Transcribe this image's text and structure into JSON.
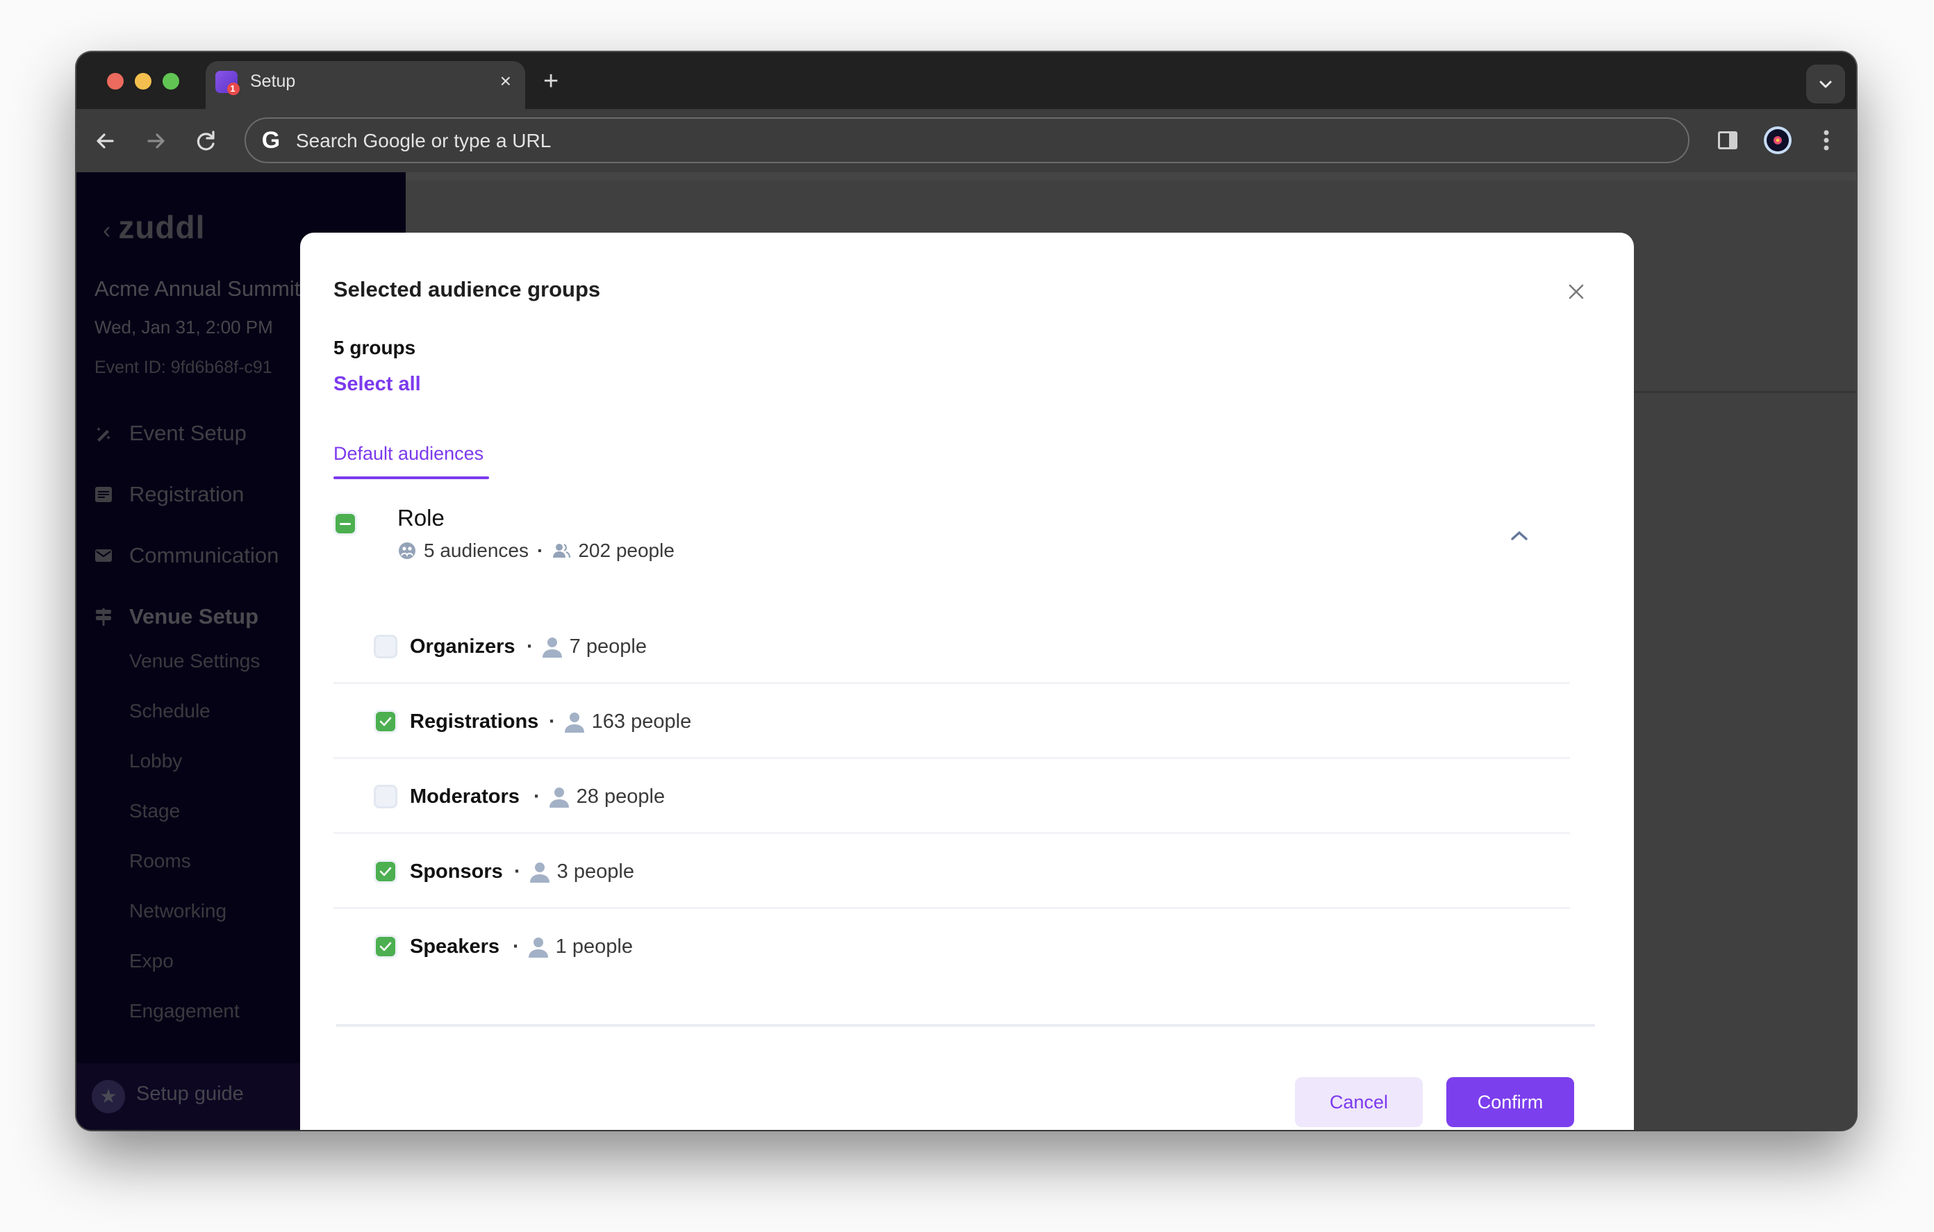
{
  "browser": {
    "tab_title": "Setup",
    "tab_badge": "1",
    "tab_close_glyph": "×",
    "new_tab_glyph": "+",
    "omnibox_placeholder": "Search Google or type a URL",
    "google_glyph": "G"
  },
  "sidebar": {
    "logo": "zuddl",
    "event_name": "Acme Annual Summit",
    "event_date": "Wed, Jan 31, 2:00 PM",
    "event_id": "Event ID: 9fd6b68f-c91",
    "nav": [
      {
        "label": "Event Setup",
        "icon": "magic-wand-icon"
      },
      {
        "label": "Registration",
        "icon": "form-icon"
      },
      {
        "label": "Communication",
        "icon": "mail-icon"
      },
      {
        "label": "Venue Setup",
        "icon": "signpost-icon"
      }
    ],
    "venue_sub_items": [
      "Venue Settings",
      "Schedule",
      "Lobby",
      "Stage",
      "Rooms",
      "Networking",
      "Expo",
      "Engagement"
    ],
    "setup_guide": "Setup guide"
  },
  "modal": {
    "title": "Selected audience groups",
    "group_count": "5 groups",
    "select_all": "Select all",
    "tab": "Default audiences",
    "group": {
      "name": "Role",
      "state": "indeterminate",
      "audiences": "5 audiences",
      "people": "202 people",
      "expanded": true
    },
    "audiences": [
      {
        "name": "Organizers",
        "people": "7 people",
        "checked": false
      },
      {
        "name": "Registrations",
        "people": "163 people",
        "checked": true
      },
      {
        "name": "Moderators",
        "people": "28 people",
        "checked": false
      },
      {
        "name": "Sponsors",
        "people": "3 people",
        "checked": true
      },
      {
        "name": "Speakers",
        "people": "1 people",
        "checked": true
      }
    ],
    "cancel": "Cancel",
    "confirm": "Confirm"
  },
  "colors": {
    "accent": "#7c3aed",
    "check_green": "#4caf50",
    "cancel_bg": "#efe7fb"
  }
}
